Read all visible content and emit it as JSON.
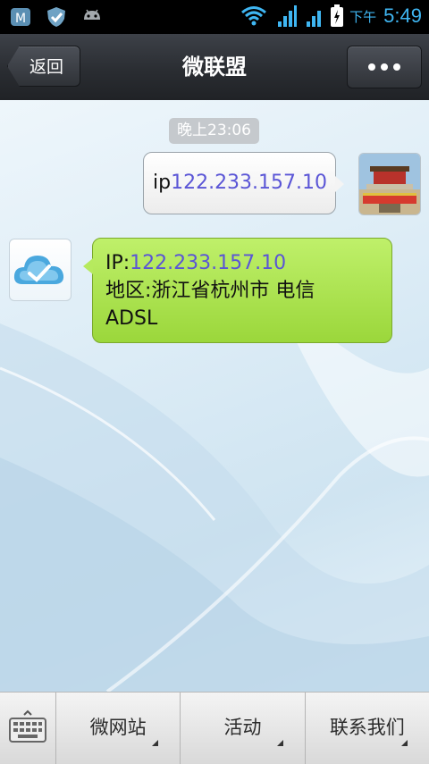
{
  "status_bar": {
    "ampm": "下午",
    "time": "5:49"
  },
  "header": {
    "back_label": "返回",
    "title": "微联盟"
  },
  "chat": {
    "timestamp": "晚上23:06",
    "outgoing": {
      "prefix": "ip",
      "ip": "122.233.157.10"
    },
    "incoming": {
      "ip_prefix": "IP:",
      "ip": "122.233.157.10",
      "line2": "地区:浙江省杭州市 电信",
      "line3": "ADSL"
    }
  },
  "bottom_menu": [
    {
      "label": "微网站"
    },
    {
      "label": "活动"
    },
    {
      "label": "联系我们"
    }
  ],
  "colors": {
    "accent": "#3fb6f2",
    "incoming_bubble": "#a8e04a",
    "link": "#5a55d6"
  }
}
